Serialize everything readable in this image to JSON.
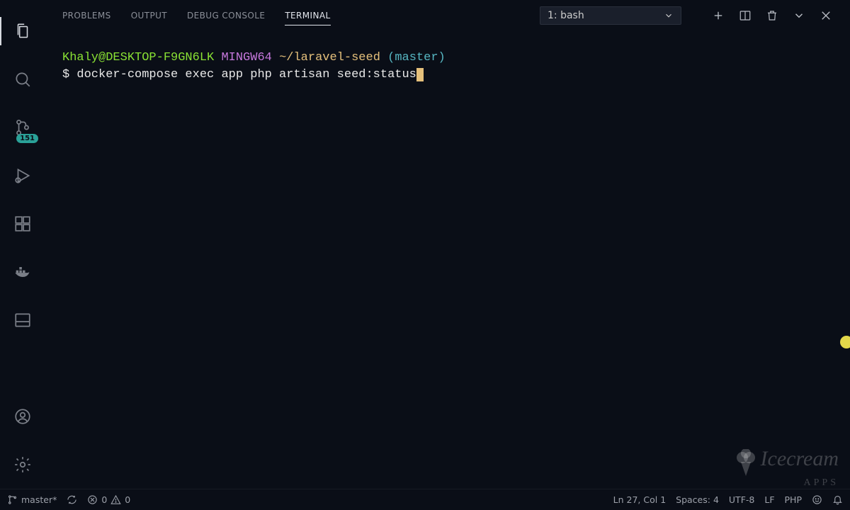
{
  "activity": {
    "scm_badge": "151"
  },
  "panel": {
    "tabs": {
      "problems": "PROBLEMS",
      "output": "OUTPUT",
      "debug_console": "DEBUG CONSOLE",
      "terminal": "TERMINAL"
    },
    "term_select": "1: bash"
  },
  "terminal": {
    "prompt": {
      "user_host": "Khaly@DESKTOP-F9GN6LK",
      "env": "MINGW64",
      "path": "~/laravel-seed",
      "branch_open": "(",
      "branch": "master",
      "branch_close": ")"
    },
    "prompt_symbol": "$",
    "command": "docker-compose exec app php artisan seed:status"
  },
  "status": {
    "branch": "master*",
    "errors": "0",
    "warnings": "0",
    "ln_col": "Ln 27, Col 1",
    "spaces": "Spaces: 4",
    "encoding": "UTF-8",
    "eol": "LF",
    "language": "PHP"
  },
  "watermark": {
    "line1": "Icecream",
    "line2": "APPS"
  }
}
